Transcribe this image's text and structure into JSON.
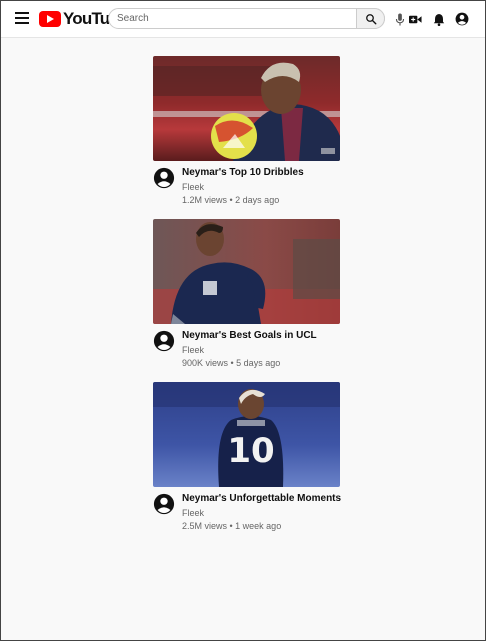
{
  "app": {
    "logo_text": "YouTube"
  },
  "search": {
    "placeholder": "Search",
    "value": ""
  },
  "header_icons": [
    "menu-icon",
    "search-icon",
    "microphone-icon",
    "create-video-icon",
    "notifications-bell-icon",
    "account-icon"
  ],
  "videos": [
    {
      "title": "Neymar's Top 10 Dribbles",
      "channel": "Fleek",
      "meta": "1.2M views • 2 days ago"
    },
    {
      "title": "Neymar's Best Goals in UCL",
      "channel": "Fleek",
      "meta": "900K views • 5 days ago"
    },
    {
      "title": "Neymar's Unforgettable Moments",
      "channel": "Fleek",
      "meta": "2.5M views • 1 week ago"
    }
  ]
}
